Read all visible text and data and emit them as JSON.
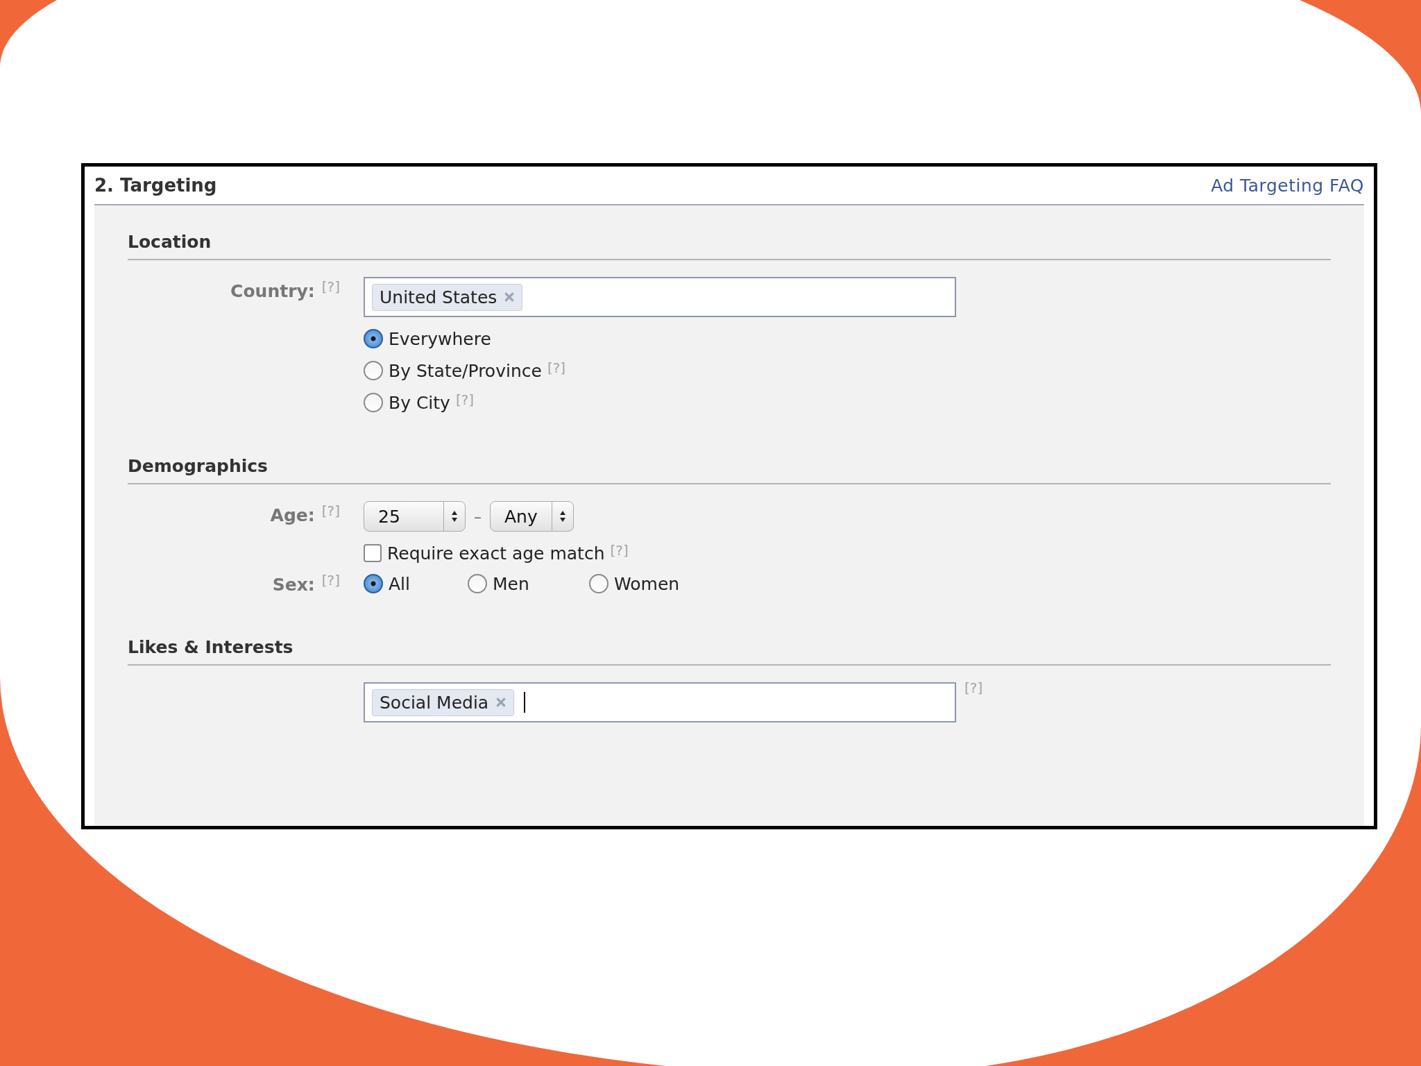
{
  "header": {
    "title": "2. Targeting",
    "link": "Ad Targeting FAQ"
  },
  "location": {
    "heading": "Location",
    "country": {
      "label": "Country:",
      "help": "[?]",
      "tokens": [
        {
          "text": "United States"
        }
      ]
    },
    "scope_options": [
      {
        "label": "Everywhere",
        "selected": true
      },
      {
        "label": "By State/Province",
        "help": "[?]",
        "selected": false
      },
      {
        "label": "By City",
        "help": "[?]",
        "selected": false
      }
    ]
  },
  "demographics": {
    "heading": "Demographics",
    "age": {
      "label": "Age:",
      "help": "[?]",
      "min": "25",
      "separator": "–",
      "max": "Any"
    },
    "exact_match": {
      "label": "Require exact age match",
      "help": "[?]",
      "checked": false
    },
    "sex": {
      "label": "Sex:",
      "help": "[?]",
      "options": [
        {
          "label": "All",
          "selected": true
        },
        {
          "label": "Men",
          "selected": false
        },
        {
          "label": "Women",
          "selected": false
        }
      ]
    }
  },
  "interests": {
    "heading": "Likes & Interests",
    "tokens": [
      {
        "text": "Social Media"
      }
    ],
    "help": "[?]"
  }
}
